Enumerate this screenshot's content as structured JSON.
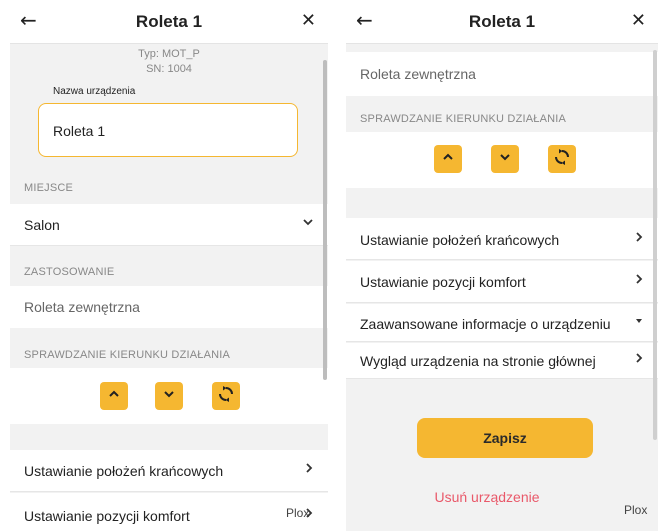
{
  "left": {
    "header": {
      "back": "←",
      "title": "Roleta 1",
      "close": "✕"
    },
    "device_type": "Typ: MOT_P",
    "serial": "SN: 1004",
    "name_label": "Nazwa urządzenia",
    "name_value": "Roleta 1",
    "place_section": "MIEJSCE",
    "place_value": "Salon",
    "place_icon": "chevron-down-icon",
    "usage_section": "ZASTOSOWANIE",
    "usage_value": "Roleta zewnętrzna",
    "direction_section": "SPRAWDZANIE KIERUNKU DZIAŁANIA",
    "direction_buttons": [
      "arrow-up-icon",
      "arrow-down-icon",
      "sync-icon"
    ],
    "menu": [
      {
        "label": "Ustawianie położeń krańcowych",
        "icon": "chevron-right-icon"
      },
      {
        "label": "Ustawianie pozycji komfort",
        "icon": "chevron-right-icon"
      }
    ],
    "watermark": "Plox"
  },
  "right": {
    "header": {
      "back": "←",
      "title": "Roleta 1",
      "close": "✕"
    },
    "usage_value": "Roleta zewnętrzna",
    "direction_section": "SPRAWDZANIE KIERUNKU DZIAŁANIA",
    "direction_buttons": [
      "arrow-up-icon",
      "arrow-down-icon",
      "sync-icon"
    ],
    "menu": [
      {
        "label": "Ustawianie położeń krańcowych",
        "icon": "chevron-right-icon"
      },
      {
        "label": "Ustawianie pozycji komfort",
        "icon": "chevron-right-icon"
      },
      {
        "label": "Zaawansowane informacje o urządzeniu",
        "icon": "caret-down-icon"
      },
      {
        "label": "Wygląd urządzenia na stronie głównej",
        "icon": "chevron-right-icon"
      }
    ],
    "save_label": "Zapisz",
    "delete_label": "Usuń urządzenie",
    "watermark": "Plox"
  },
  "colors": {
    "accent": "#f5b731",
    "danger": "#e9596a",
    "background": "#f2f2f2"
  }
}
